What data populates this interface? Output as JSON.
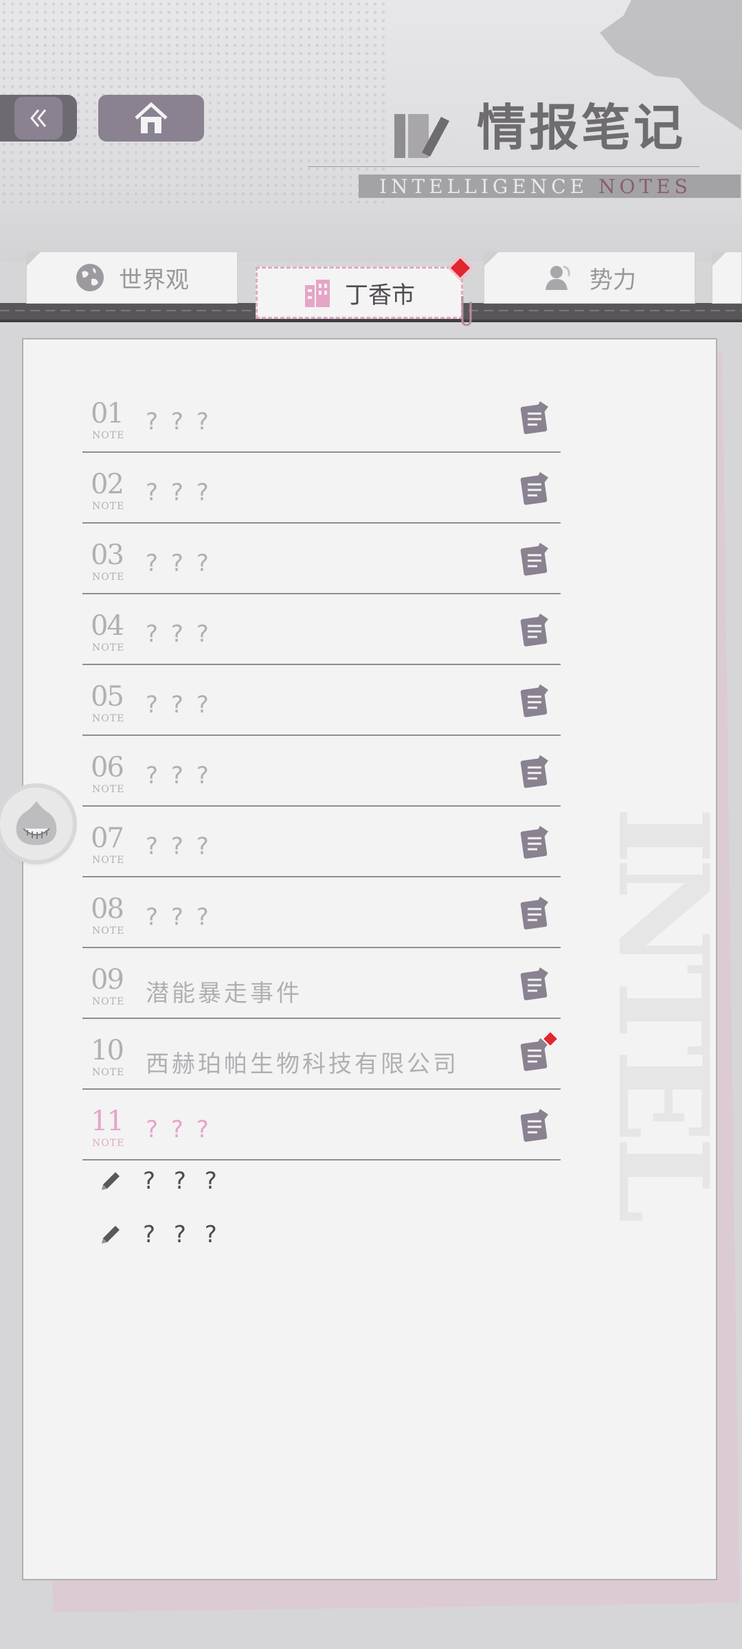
{
  "header": {
    "title_cn": "情报笔记",
    "title_en_main": "INTELLIGENCE",
    "title_en_accent": "NOTES"
  },
  "tabs": [
    {
      "label": "世界观",
      "icon": "globe-icon",
      "active": false
    },
    {
      "label": "丁香市",
      "icon": "building-icon",
      "active": true,
      "badge": true
    },
    {
      "label": "势力",
      "icon": "person-icon",
      "active": false
    }
  ],
  "notes": [
    {
      "num": "01",
      "tag": "NOTE",
      "title": "? ? ?"
    },
    {
      "num": "02",
      "tag": "NOTE",
      "title": "? ? ?"
    },
    {
      "num": "03",
      "tag": "NOTE",
      "title": "? ? ?"
    },
    {
      "num": "04",
      "tag": "NOTE",
      "title": "? ? ?"
    },
    {
      "num": "05",
      "tag": "NOTE",
      "title": "? ? ?"
    },
    {
      "num": "06",
      "tag": "NOTE",
      "title": "? ? ?"
    },
    {
      "num": "07",
      "tag": "NOTE",
      "title": "? ? ?"
    },
    {
      "num": "08",
      "tag": "NOTE",
      "title": "? ? ?"
    },
    {
      "num": "09",
      "tag": "NOTE",
      "title": "潜能暴走事件"
    },
    {
      "num": "10",
      "tag": "NOTE",
      "title": "西赫珀帕生物科技有限公司",
      "badge": true
    },
    {
      "num": "11",
      "tag": "NOTE",
      "title": "? ? ?",
      "highlight": true
    }
  ],
  "sub_items": [
    {
      "label": "? ? ?"
    },
    {
      "label": "? ? ?"
    }
  ],
  "colors": {
    "accent_pink": "#e6a5c6",
    "badge_red": "#e1262f",
    "button_mauve": "#8a8290"
  }
}
